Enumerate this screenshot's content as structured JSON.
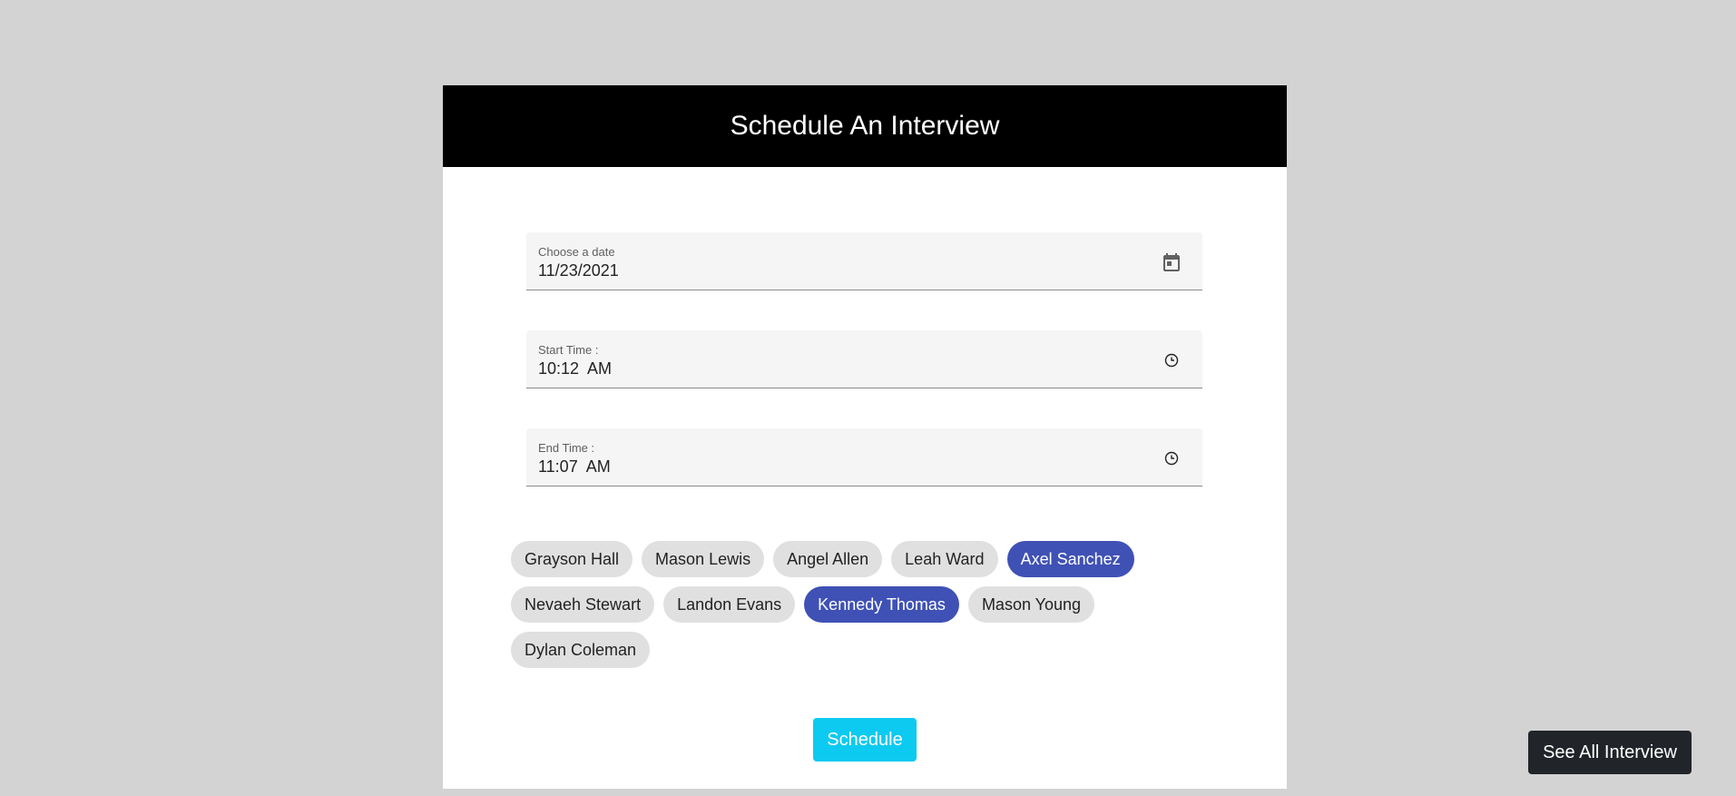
{
  "header": {
    "title": "Schedule An Interview"
  },
  "date_field": {
    "label": "Choose a date",
    "value": "11/23/2021",
    "icon": "calendar-icon"
  },
  "start_time_field": {
    "label": "Start Time :",
    "value": "10:12  AM",
    "icon": "clock-icon"
  },
  "end_time_field": {
    "label": "End Time :",
    "value": "11:07  AM",
    "icon": "clock-icon"
  },
  "participants": [
    {
      "name": "Grayson Hall",
      "selected": false
    },
    {
      "name": "Mason Lewis",
      "selected": false
    },
    {
      "name": "Angel Allen",
      "selected": false
    },
    {
      "name": "Leah Ward",
      "selected": false
    },
    {
      "name": "Axel Sanchez",
      "selected": true
    },
    {
      "name": "Nevaeh Stewart",
      "selected": false
    },
    {
      "name": "Landon Evans",
      "selected": false
    },
    {
      "name": "Kennedy Thomas",
      "selected": true
    },
    {
      "name": "Mason Young",
      "selected": false
    },
    {
      "name": "Dylan Coleman",
      "selected": false
    }
  ],
  "actions": {
    "schedule_label": "Schedule",
    "see_all_label": "See All Interview"
  },
  "colors": {
    "header_bg": "#000000",
    "chip_selected": "#3f51b5",
    "chip_default": "#e0e0e0",
    "schedule_button": "#0dcaf0",
    "see_all_button": "#212529",
    "page_bg": "#d3d3d3"
  }
}
